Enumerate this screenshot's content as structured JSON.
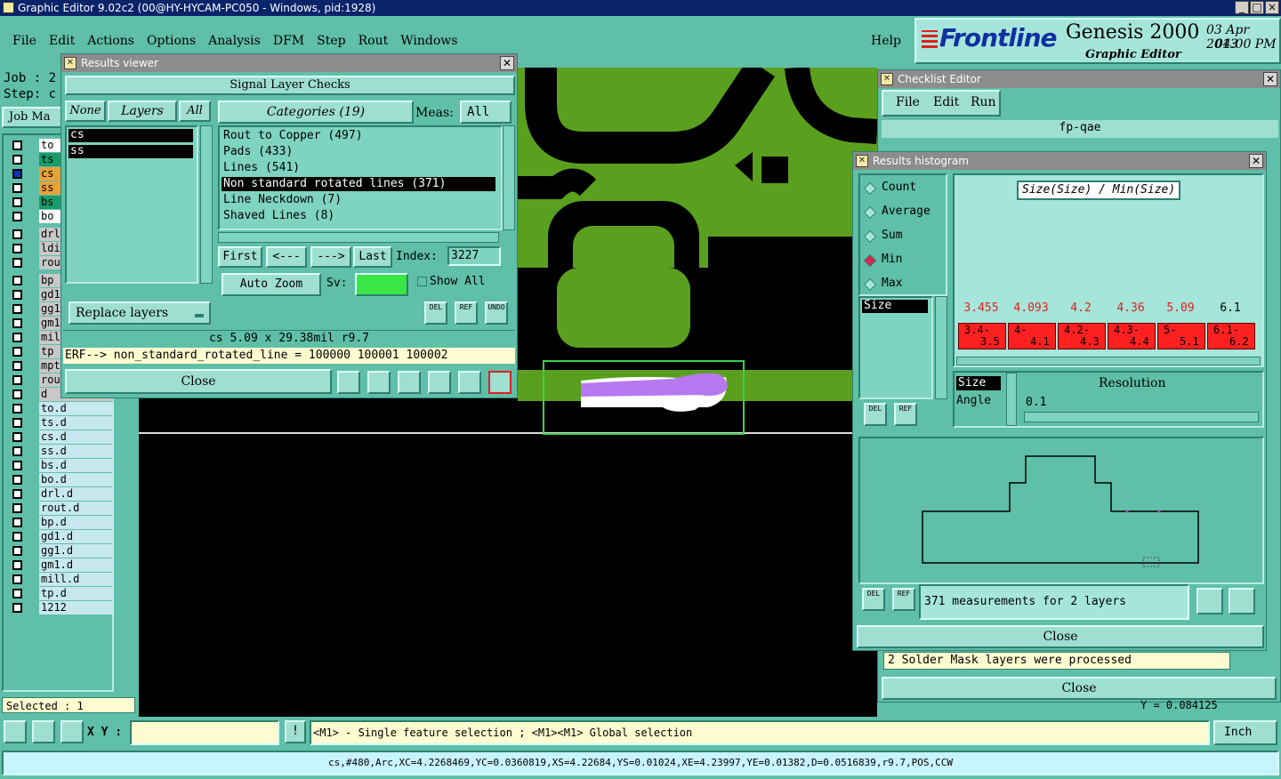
{
  "app": {
    "title": "Graphic Editor 9.02c2 (00@HY-HYCAM-PC050 - Windows, pid:1928)",
    "menu": [
      "File",
      "Edit",
      "Actions",
      "Options",
      "Analysis",
      "DFM",
      "Step",
      "Rout",
      "Windows"
    ],
    "help": "Help",
    "brand": "Frontline",
    "product": "Genesis 2000",
    "subtitle": "Graphic Editor",
    "date": "03 Apr 2013",
    "time": "04:00 PM",
    "job_label": "Job : 2",
    "step_label": "Step: c",
    "job_matrix_btn": "Job Ma",
    "selected": "Selected : 1"
  },
  "layers": [
    {
      "name": "to",
      "color": "#ffffff"
    },
    {
      "name": "ts",
      "color": "#1a9b6a"
    },
    {
      "name": "cs",
      "color": "#e8a23a"
    },
    {
      "name": "ss",
      "color": "#e8a23a"
    },
    {
      "name": "bs",
      "color": "#1a9b6a"
    },
    {
      "name": "bo",
      "color": "#ffffff"
    },
    {
      "name": "drl",
      "color": "#c8c8c8"
    },
    {
      "name": "ldi",
      "color": "#c8c8c8"
    },
    {
      "name": "rout",
      "color": "#c8c8c8"
    },
    {
      "name": "bp",
      "color": "#c8c8c8"
    },
    {
      "name": "gd1",
      "color": "#c8c8c8"
    },
    {
      "name": "gg1",
      "color": "#c8c8c8"
    },
    {
      "name": "gm1",
      "color": "#c8c8c8"
    },
    {
      "name": "mill",
      "color": "#c8c8c8"
    },
    {
      "name": "tp",
      "color": "#c8c8c8"
    },
    {
      "name": "mptl",
      "color": "#c8c8c8"
    },
    {
      "name": "rout",
      "color": "#c8c8c8"
    },
    {
      "name": "d",
      "color": "#c8c8c8"
    },
    {
      "name": "to.d",
      "color": "#c8e8f0"
    },
    {
      "name": "ts.d",
      "color": "#c8e8f0"
    },
    {
      "name": "cs.d",
      "color": "#c8e8f0"
    },
    {
      "name": "ss.d",
      "color": "#c8e8f0"
    },
    {
      "name": "bs.d",
      "color": "#c8e8f0"
    },
    {
      "name": "bo.d",
      "color": "#c8e8f0"
    },
    {
      "name": "drl.d",
      "color": "#c8e8f0"
    },
    {
      "name": "rout.d",
      "color": "#c8e8f0"
    },
    {
      "name": "bp.d",
      "color": "#c8e8f0"
    },
    {
      "name": "gd1.d",
      "color": "#c8e8f0"
    },
    {
      "name": "gg1.d",
      "color": "#c8e8f0"
    },
    {
      "name": "gm1.d",
      "color": "#c8e8f0"
    },
    {
      "name": "mill.d",
      "color": "#c8e8f0"
    },
    {
      "name": "tp.d",
      "color": "#c8e8f0"
    },
    {
      "name": "1212",
      "color": "#c8e8f0"
    }
  ],
  "results_viewer": {
    "title": "Results viewer",
    "header": "Signal Layer Checks",
    "none_btn": "None",
    "layers_btn": "Layers",
    "all_btn": "All",
    "layer_items": [
      "cs",
      "ss"
    ],
    "categories_btn": "Categories (19)",
    "meas_label": "Meas:",
    "meas_value": "All",
    "categories": [
      "Rout to Copper (497)",
      "Pads (433)",
      "Lines (541)",
      "Non standard rotated lines (371)",
      "Line Neckdown (7)",
      "Shaved Lines (8)"
    ],
    "selected_category": 3,
    "first_btn": "First",
    "prev_btn": "<---",
    "next_btn": "--->",
    "last_btn": "Last",
    "index_label": "Index:",
    "index_value": "3227",
    "auto_zoom": "Auto Zoom",
    "sv_label": "Sv:",
    "show_all": "Show All",
    "replace_layers": "Replace layers",
    "del": "DEL",
    "ref": "REF",
    "undo": "UNDO",
    "measure_line": "cs 5.09 x 29.38mil  r9.7",
    "erf_line": "ERF--> non_standard_rotated_line = 100000 100001 100002",
    "close": "Close"
  },
  "checklist_editor": {
    "title": "Checklist Editor",
    "menu": [
      "File",
      "Edit",
      "Run"
    ],
    "checklist_name": "fp-qae",
    "message": "2 Solder Mask layers were processed",
    "close": "Close",
    "coord_readout": "Y = 0.084125"
  },
  "histogram": {
    "title": "Results histogram",
    "options": [
      "Count",
      "Average",
      "Sum",
      "Min",
      "Max"
    ],
    "selected_option": 3,
    "chart_title": "Size(Size) / Min(Size)",
    "bin_values": [
      "3.455",
      "4.093",
      "4.2",
      "4.36",
      "5.09",
      "6.1"
    ],
    "bin_ranges": [
      [
        "3.4-",
        "3.5"
      ],
      [
        "4-",
        "4.1"
      ],
      [
        "4.2-",
        "4.3"
      ],
      [
        "4.3-",
        "4.4"
      ],
      [
        "5-",
        "5.1"
      ],
      [
        "6.1-",
        "6.2"
      ]
    ],
    "attr_list": [
      "Size"
    ],
    "size_btn": "Size",
    "angle_btn": "Angle",
    "resolution_label": "Resolution",
    "resolution_value": "0.1",
    "del": "DEL",
    "ref": "REF",
    "measurements": "371 measurements for 2 layers",
    "close": "Close"
  },
  "status": {
    "xy_label": "X Y :",
    "xy_value": "",
    "hint": "<M1> - Single feature selection ; <M1><M1> Global selection",
    "units": "Inch",
    "feature_info": "cs,#480,Arc,XC=4.2268469,YC=0.0360819,XS=4.22684,YS=0.01024,XE=4.23997,YE=0.01382,D=0.0516839,r9.7,POS,CCW"
  },
  "colors": {
    "copper": "#5aa01e",
    "canvas": "#000000",
    "highlight": "#b878f0",
    "select_box": "#39d24a",
    "ui_bg": "#5fbfa8",
    "hist_bar": "#ff2020"
  }
}
